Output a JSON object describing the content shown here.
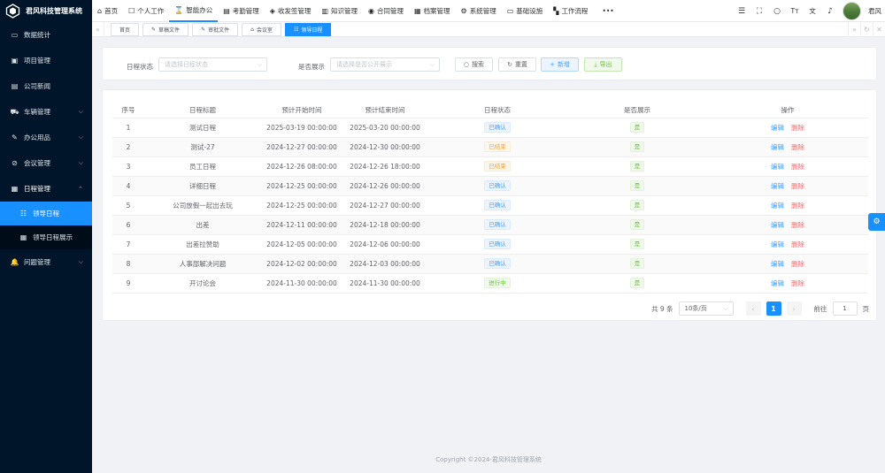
{
  "app": {
    "title": "君风科技管理系统"
  },
  "sidebar": {
    "items": [
      {
        "label": "数据统计",
        "icon": "dashboard-icon"
      },
      {
        "label": "项目管理",
        "icon": "project-icon"
      },
      {
        "label": "公司新闻",
        "icon": "news-icon"
      },
      {
        "label": "车辆管理",
        "icon": "car-icon"
      },
      {
        "label": "办公用品",
        "icon": "supplies-icon"
      },
      {
        "label": "会议管理",
        "icon": "meeting-icon"
      },
      {
        "label": "日程管理",
        "icon": "calendar-icon"
      },
      {
        "label": "问题管理",
        "icon": "bell-icon"
      }
    ],
    "subitems": [
      {
        "label": "领导日程",
        "icon": "list-icon"
      },
      {
        "label": "领导日程展示",
        "icon": "calendar-icon"
      }
    ]
  },
  "topnav": {
    "items": [
      "首页",
      "个人工作",
      "智能办公",
      "考勤管理",
      "收发签管理",
      "知识管理",
      "合同管理",
      "档案管理",
      "系统管理",
      "基础设施",
      "工作流程"
    ],
    "more": "•••",
    "user": "君风"
  },
  "tags": [
    "首页",
    "草稿文件",
    "审批文件",
    "会议室",
    "领导日程"
  ],
  "search": {
    "status_label": "日程状态",
    "status_placeholder": "请选择日程状态",
    "public_label": "是否展示",
    "public_placeholder": "请选择是否公开展示",
    "btn_search": "搜索",
    "btn_reset": "重置",
    "btn_add": "新增",
    "btn_export": "导出"
  },
  "table": {
    "headers": [
      "序号",
      "日程标题",
      "预计开始时间",
      "预计结束时间",
      "日程状态",
      "是否展示",
      "操作"
    ],
    "edit_label": "编辑",
    "delete_label": "删除",
    "rows": [
      {
        "no": "1",
        "title": "测试日程",
        "start": "2025-03-19 00:00:00",
        "end": "2025-03-20 00:00:00",
        "status": "已确认",
        "status_color": "blue",
        "show": "是"
      },
      {
        "no": "2",
        "title": "测试-27",
        "start": "2024-12-27 00:00:00",
        "end": "2024-12-30 00:00:00",
        "status": "已结束",
        "status_color": "orange",
        "show": "是"
      },
      {
        "no": "3",
        "title": "员工日程",
        "start": "2024-12-26 08:00:00",
        "end": "2024-12-26 18:00:00",
        "status": "已结束",
        "status_color": "orange",
        "show": "是"
      },
      {
        "no": "4",
        "title": "详细日程",
        "start": "2024-12-25 00:00:00",
        "end": "2024-12-26 00:00:00",
        "status": "已确认",
        "status_color": "blue",
        "show": "是"
      },
      {
        "no": "5",
        "title": "公司放假一起出去玩",
        "start": "2024-12-25 00:00:00",
        "end": "2024-12-27 00:00:00",
        "status": "已确认",
        "status_color": "blue",
        "show": "是"
      },
      {
        "no": "6",
        "title": "出差",
        "start": "2024-12-11 00:00:00",
        "end": "2024-12-18 00:00:00",
        "status": "已确认",
        "status_color": "blue",
        "show": "是"
      },
      {
        "no": "7",
        "title": "出差拉赞助",
        "start": "2024-12-05 00:00:00",
        "end": "2024-12-06 00:00:00",
        "status": "已确认",
        "status_color": "blue",
        "show": "是"
      },
      {
        "no": "8",
        "title": "人事部解决问题",
        "start": "2024-12-02 00:00:00",
        "end": "2024-12-03 00:00:00",
        "status": "已确认",
        "status_color": "blue",
        "show": "是"
      },
      {
        "no": "9",
        "title": "开讨论会",
        "start": "2024-11-30 00:00:00",
        "end": "2024-11-30 00:00:00",
        "status": "进行中",
        "status_color": "green",
        "show": "是"
      }
    ]
  },
  "pagination": {
    "total": "共 9 条",
    "page_size": "10条/页",
    "current": "1",
    "goto_label": "前往",
    "goto_value": "1",
    "page_suffix": "页"
  },
  "footer": "Copyright ©2024-君风科技管理系统",
  "colors": {
    "accent": "#1890ff",
    "sidebar_bg": "#001529",
    "danger": "#f56c6c"
  }
}
